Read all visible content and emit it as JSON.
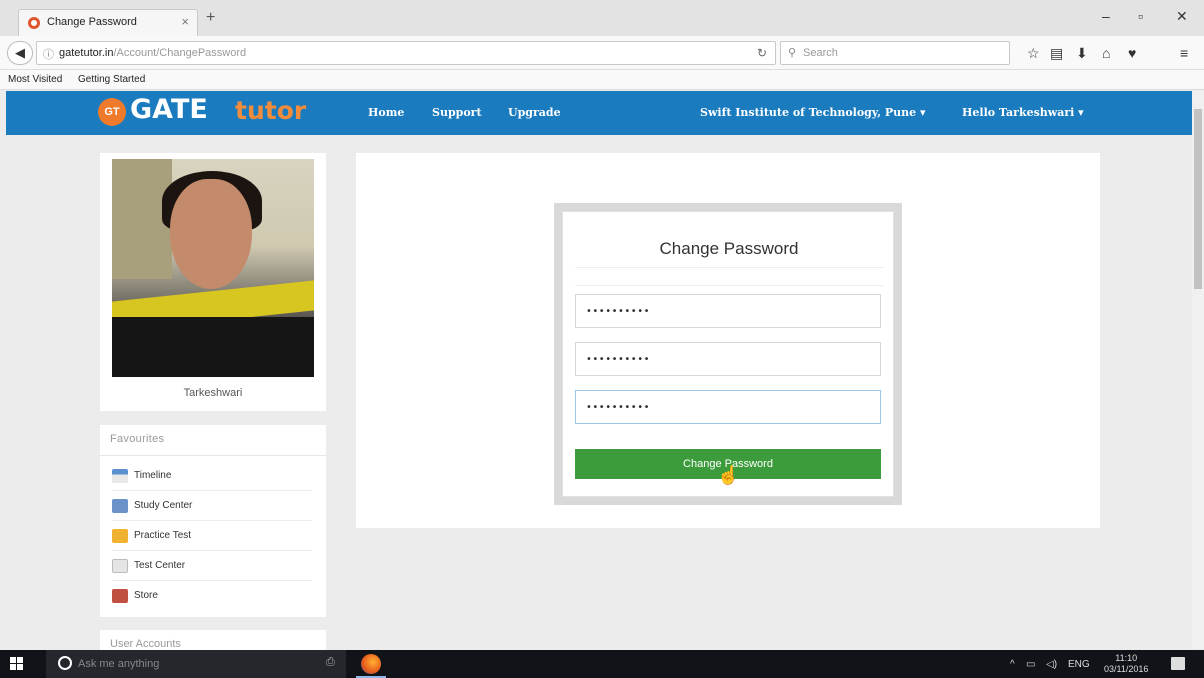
{
  "browser": {
    "tab_title": "Change Password",
    "tab_close": "×",
    "new_tab": "+",
    "url_host": "gatetutor.in",
    "url_path": "/Account/ChangePassword",
    "search_placeholder": "Search",
    "bookmarks": [
      "Most Visited",
      "Getting Started"
    ]
  },
  "header": {
    "logo_badge": "GT",
    "logo_gate": "GATE",
    "logo_tutor": "tutor",
    "nav": [
      "Home",
      "Support",
      "Upgrade"
    ],
    "institute": "Swift Institute of Technology, Pune ▾",
    "greeting": "Hello Tarkeshwari ▾"
  },
  "profile": {
    "name": "Tarkeshwari"
  },
  "favourites": {
    "title": "Favourites",
    "items": [
      {
        "label": "Timeline",
        "icon": "timeline-icon"
      },
      {
        "label": "Study Center",
        "icon": "study-center-icon"
      },
      {
        "label": "Practice Test",
        "icon": "practice-test-icon"
      },
      {
        "label": "Test Center",
        "icon": "test-center-icon"
      },
      {
        "label": "Store",
        "icon": "store-icon"
      }
    ]
  },
  "accounts": {
    "title": "User Accounts"
  },
  "change_password": {
    "title": "Change Password",
    "current_password": "••••••••••",
    "new_password": "••••••••••",
    "confirm_password": "••••••••••",
    "button": "Change Password"
  },
  "taskbar": {
    "search_placeholder": "Ask me anything",
    "lang": "ENG",
    "time": "11:10",
    "date": "03/11/2016"
  },
  "colors": {
    "header_blue": "#1a7bbf",
    "logo_orange": "#f07a2c",
    "button_green": "#3c9c3c"
  }
}
